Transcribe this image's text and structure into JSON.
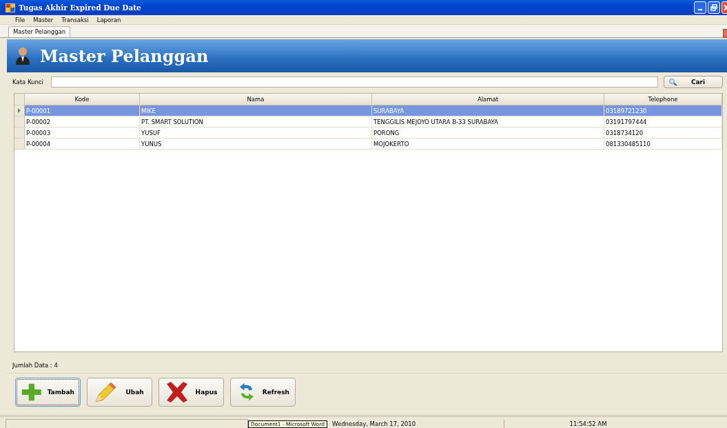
{
  "window": {
    "title": "Tugas Akhir Expired Due Date"
  },
  "menu": [
    "File",
    "Master",
    "Transaksi",
    "Laporan"
  ],
  "tabs": [
    {
      "label": "Master Pelanggan",
      "selected": true
    }
  ],
  "header": {
    "title": "Master Pelanggan"
  },
  "search": {
    "label": "Kata Kunci",
    "button": "Cari"
  },
  "table": {
    "columns": [
      "Kode",
      "Nama",
      "Alamat",
      "Telephone"
    ],
    "rows": [
      {
        "cells": [
          "P-00001",
          "MIKE",
          "SURABAYA",
          "03189721230"
        ],
        "selected": true
      },
      {
        "cells": [
          "P-00002",
          "PT. SMART SOLUTION",
          "TENGGILIS MEJOYO UTARA B-33 SURABAYA",
          "03191797444"
        ],
        "selected": false
      },
      {
        "cells": [
          "P-00003",
          "YUSUF",
          "PORONG",
          "0318734120"
        ],
        "selected": false
      },
      {
        "cells": [
          "P-00004",
          "YUNUS",
          "MOJOKERTO",
          "081330485110"
        ],
        "selected": false
      }
    ]
  },
  "count": "Jumlah Data : 4",
  "buttons": [
    {
      "kind": "add",
      "label": "Tambah",
      "focused": true
    },
    {
      "kind": "edit",
      "label": "Ubah",
      "focused": false
    },
    {
      "kind": "delete",
      "label": "Hapus",
      "focused": false
    },
    {
      "kind": "refresh",
      "label": "Refresh",
      "focused": false
    }
  ],
  "status_bar": {
    "tooltip": "Document1 - Microsoft Word",
    "date": "Wednesday, March 17, 2010",
    "time": "11:54:52 AM"
  }
}
